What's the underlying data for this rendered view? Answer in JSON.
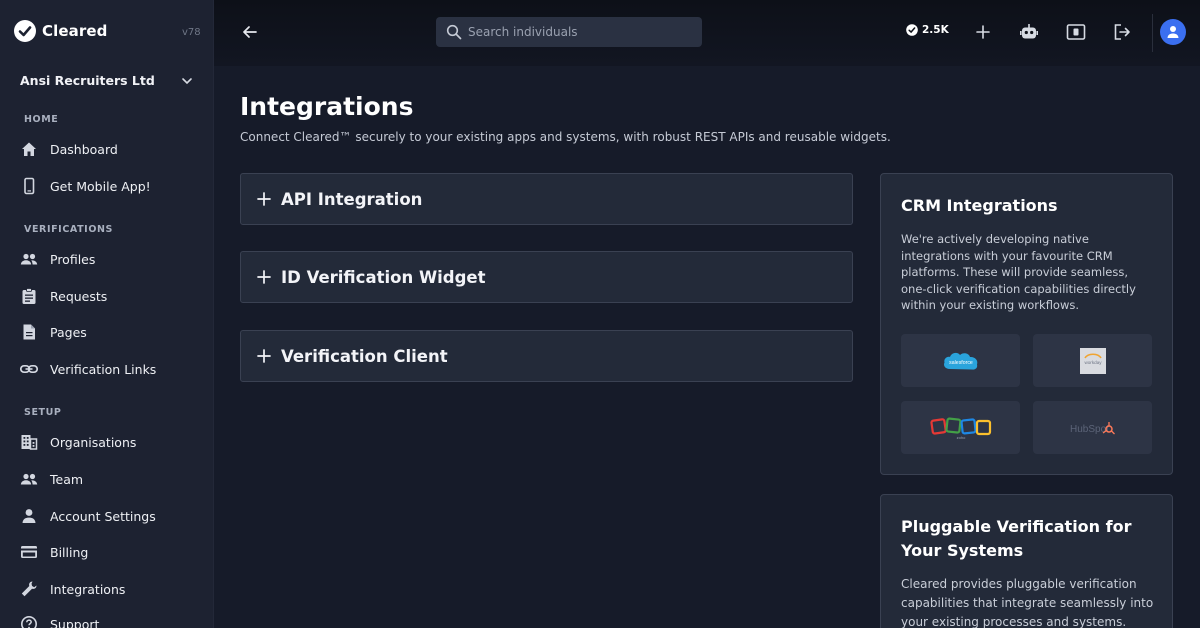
{
  "brand": {
    "name": "Cleared",
    "version": "v78"
  },
  "org": {
    "name": "Ansi Recruiters Ltd"
  },
  "sidebar": {
    "sections": [
      {
        "label": "HOME"
      },
      {
        "label": "VERIFICATIONS"
      },
      {
        "label": "SETUP"
      }
    ],
    "items": [
      {
        "label": "Dashboard",
        "icon": "home-icon"
      },
      {
        "label": "Get Mobile App!",
        "icon": "phone-icon"
      },
      {
        "label": "Profiles",
        "icon": "people-icon"
      },
      {
        "label": "Requests",
        "icon": "clipboard-icon"
      },
      {
        "label": "Pages",
        "icon": "document-icon"
      },
      {
        "label": "Verification Links",
        "icon": "link-icon"
      },
      {
        "label": "Organisations",
        "icon": "building-icon"
      },
      {
        "label": "Team",
        "icon": "people-icon"
      },
      {
        "label": "Account Settings",
        "icon": "person-icon"
      },
      {
        "label": "Billing",
        "icon": "credit-card-icon"
      },
      {
        "label": "Integrations",
        "icon": "wrench-icon"
      },
      {
        "label": "Support",
        "icon": "help-icon"
      }
    ]
  },
  "topbar": {
    "search_placeholder": "Search individuals",
    "credits": "2.5K"
  },
  "main": {
    "title": "Integrations",
    "subtitle": "Connect Cleared™ securely to your existing apps and systems, with robust REST APIs and reusable widgets.",
    "accordions": [
      {
        "label": "API Integration"
      },
      {
        "label": "ID Verification Widget"
      },
      {
        "label": "Verification Client"
      }
    ]
  },
  "crm_card": {
    "title": "CRM Integrations",
    "text": "We're actively developing native integrations with your favourite CRM platforms. These will provide seamless, one-click verification capabilities directly within your existing workflows.",
    "logos": [
      "salesforce",
      "workday",
      "zoho",
      "HubSpot"
    ]
  },
  "pluggable_card": {
    "title": "Pluggable Verification for Your Systems",
    "text": "Cleared provides pluggable verification capabilities that integrate seamlessly into your existing processes and systems."
  },
  "colors": {
    "background": "#161b29",
    "sidebar": "#1d2231",
    "card": "#232a39",
    "accent": "#3b6ff0"
  }
}
